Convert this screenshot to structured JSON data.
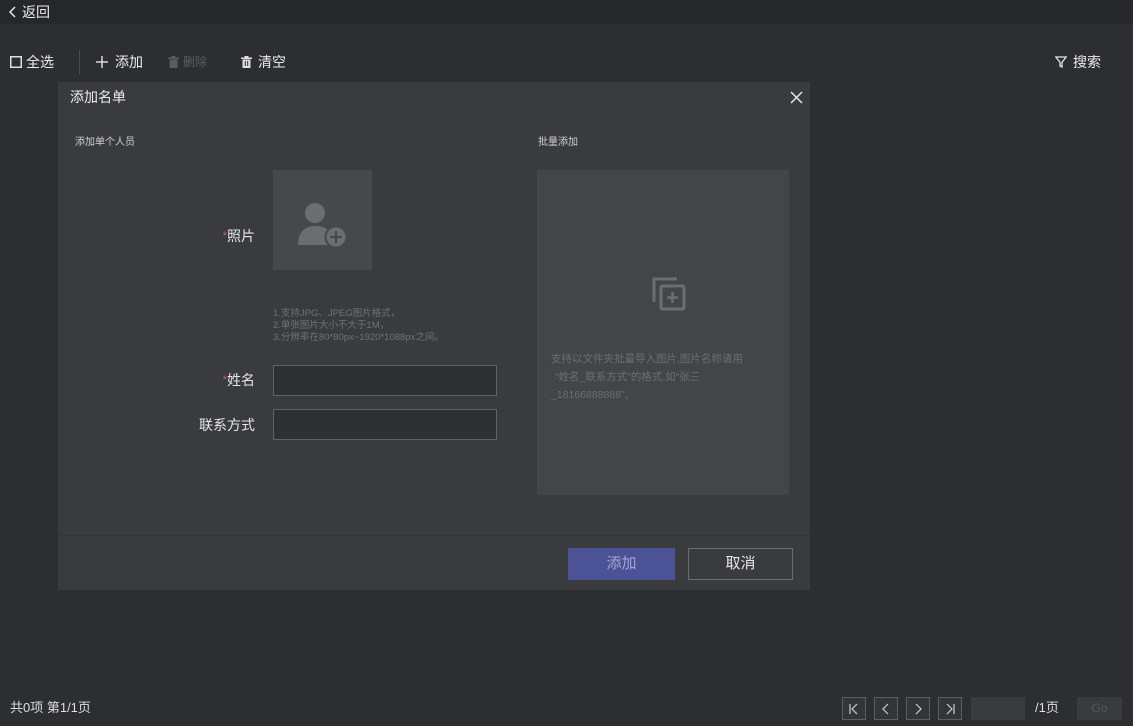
{
  "header": {
    "back_label": "返回"
  },
  "toolbar": {
    "select_all": "全选",
    "add": "添加",
    "delete": "删除",
    "clear": "清空",
    "search": "搜索"
  },
  "dialog": {
    "title": "添加名单",
    "single_section_title": "添加单个人员",
    "batch_section_title": "批量添加",
    "required_mark": "*",
    "photo_label": "照片",
    "photo_hints": [
      "1.支持JPG、JPEG图片格式，",
      "2.单张图片大小不大于1M，",
      "3.分辨率在80*80px~1920*1088px之间。"
    ],
    "name_label": "姓名",
    "name_value": "",
    "contact_label": "联系方式",
    "contact_value": "",
    "batch_hint": [
      "支持以文件夹批量导入图片,图片名称请用",
      "“姓名_联系方式”的格式,如“张三",
      "_18166888888”。"
    ],
    "add_button": "添加",
    "cancel_button": "取消"
  },
  "footer": {
    "summary": "共0项 第1/1页",
    "page_input": "",
    "total_pages": "/1页",
    "go": "Go"
  },
  "colors": {
    "background": "#2d2e32",
    "dialog": "#3a3b3f",
    "primary_button": "#4b5296",
    "required": "#e05656"
  }
}
